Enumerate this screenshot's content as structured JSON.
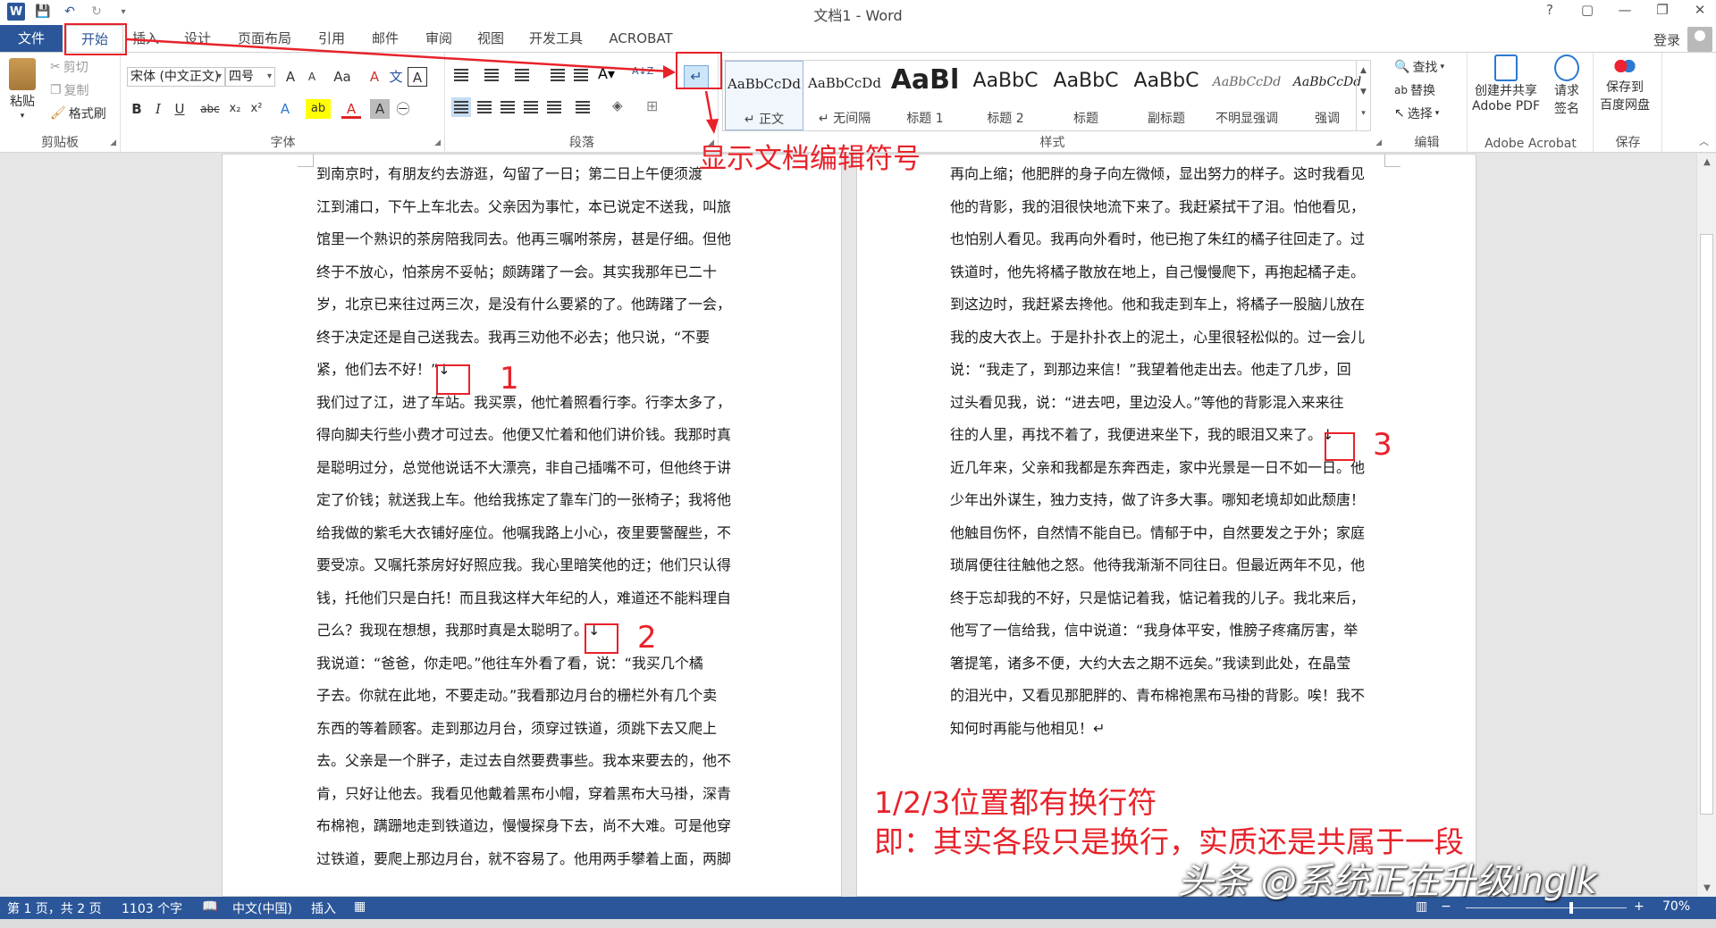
{
  "window": {
    "title": "文档1 - Word",
    "help": "?",
    "ribbon_display": "▢",
    "minimize": "—",
    "restore": "❐",
    "close": "✕"
  },
  "qat": {
    "word_logo": "W",
    "save": "💾",
    "undo": "↶",
    "redo": "↻",
    "more": "▾"
  },
  "tabs": [
    "文件",
    "开始",
    "插入",
    "设计",
    "页面布局",
    "引用",
    "邮件",
    "审阅",
    "视图",
    "开发工具",
    "ACROBAT"
  ],
  "active_tab": "开始",
  "account": {
    "login": "登录"
  },
  "clipboard": {
    "paste": "粘贴",
    "cut": "剪切",
    "copy": "复制",
    "format_painter": "格式刷",
    "label": "剪贴板"
  },
  "font": {
    "name": "宋体 (中文正文)",
    "size": "四号",
    "label": "字体",
    "grow": "A",
    "shrink": "A",
    "case": "Aa",
    "clear": "A",
    "phonetic": "文",
    "border": "A",
    "bold": "B",
    "italic": "I",
    "underline": "U",
    "strike": "abc",
    "sub": "x₂",
    "sup": "x²",
    "effect": "A",
    "highlight": "ab",
    "color": "A",
    "shade": "A",
    "enclose": "㊀"
  },
  "paragraph": {
    "label": "段落"
  },
  "styles": {
    "label": "样式",
    "items": [
      {
        "preview": "AaBbCcDd",
        "name": "↵ 正文"
      },
      {
        "preview": "AaBbCcDd",
        "name": "↵ 无间隔"
      },
      {
        "preview": "AaBl",
        "name": "标题 1"
      },
      {
        "preview": "AaBbC",
        "name": "标题 2"
      },
      {
        "preview": "AaBbC",
        "name": "标题"
      },
      {
        "preview": "AaBbC",
        "name": "副标题"
      },
      {
        "preview": "AaBbCcDd",
        "name": "不明显强调"
      },
      {
        "preview": "AaBbCcDd",
        "name": "强调"
      }
    ]
  },
  "editing": {
    "find": "查找",
    "replace": "替换",
    "select": "选择",
    "label": "编辑"
  },
  "acrobat": {
    "create_share": "创建并共享",
    "create_share2": "Adobe PDF",
    "request": "请求",
    "request2": "签名",
    "label": "Adobe Acrobat"
  },
  "save_cloud": {
    "line1": "保存到",
    "line2": "百度网盘",
    "label": "保存"
  },
  "document": {
    "left_lines": [
      "到南京时，有朋友约去游逛，勾留了一日；第二日上午便须渡",
      "江到浦口，下午上车北去。父亲因为事忙，本已说定不送我，叫旅",
      "馆里一个熟识的茶房陪我同去。他再三嘱咐茶房，甚是仔细。但他",
      "终于不放心，怕茶房不妥帖；颇踌躇了一会。其实我那年已二十",
      "岁，北京已来往过两三次，是没有什么要紧的了。他踌躇了一会，",
      "终于决定还是自己送我去。我再三劝他不必去；他只说，“不要",
      "紧，他们去不好！”↓",
      "我们过了江，进了车站。我买票，他忙着照看行李。行李太多了，",
      "得向脚夫行些小费才可过去。他便又忙着和他们讲价钱。我那时真",
      "是聪明过分，总觉他说话不大漂亮，非自己插嘴不可，但他终于讲",
      "定了价钱；就送我上车。他给我拣定了靠车门的一张椅子；我将他",
      "给我做的紫毛大衣铺好座位。他嘱我路上小心，夜里要警醒些，不",
      "要受凉。又嘱托茶房好好照应我。我心里暗笑他的迂；他们只认得",
      "钱，托他们只是白托！而且我这样大年纪的人，难道还不能料理自",
      "己么？我现在想想，我那时真是太聪明了。↓",
      "我说道：“爸爸，你走吧。”他往车外看了看，说：“我买几个橘",
      "子去。你就在此地，不要走动。”我看那边月台的栅栏外有几个卖",
      "东西的等着顾客。走到那边月台，须穿过铁道，须跳下去又爬上",
      "去。父亲是一个胖子，走过去自然要费事些。我本来要去的，他不",
      "肯，只好让他去。我看见他戴着黑布小帽，穿着黑布大马褂，深青",
      "布棉袍，蹒跚地走到铁道边，慢慢探身下去，尚不大难。可是他穿",
      "过铁道，要爬上那边月台，就不容易了。他用两手攀着上面，两脚"
    ],
    "right_lines": [
      "再向上缩；他肥胖的身子向左微倾，显出努力的样子。这时我看见",
      "他的背影，我的泪很快地流下来了。我赶紧拭干了泪。怕他看见，",
      "也怕别人看见。我再向外看时，他已抱了朱红的橘子往回走了。过",
      "铁道时，他先将橘子散放在地上，自己慢慢爬下，再抱起橘子走。",
      "到这边时，我赶紧去搀他。他和我走到车上，将橘子一股脑儿放在",
      "我的皮大衣上。于是扑扑衣上的泥土，心里很轻松似的。过一会儿",
      "说：“我走了，到那边来信！”我望着他走出去。他走了几步，回",
      "过头看见我，说：“进去吧，里边没人。”等他的背影混入来来往",
      "往的人里，再找不着了，我便进来坐下，我的眼泪又来了。↓",
      "近几年来，父亲和我都是东奔西走，家中光景是一日不如一日。他",
      "少年出外谋生，独力支持，做了许多大事。哪知老境却如此颓唐！",
      "他触目伤怀，自然情不能自已。情郁于中，自然要发之于外；家庭",
      "琐屑便往往触他之怒。他待我渐渐不同往日。但最近两年不见，他",
      "终于忘却我的不好，只是惦记着我，惦记着我的儿子。我北来后，",
      "他写了一信给我，信中说道：“我身体平安，惟膀子疼痛厉害，举",
      "箸提笔，诸多不便，大约大去之期不远矣。”我读到此处，在晶莹",
      "的泪光中，又看见那肥胖的、青布棉袍黑布马褂的背影。唉！我不",
      "知何时再能与他相见！↵"
    ]
  },
  "status": {
    "page": "第 1 页，共 2 页",
    "words": "1103 个字",
    "lang": "中文(中国)",
    "insert": "插入",
    "zoom": "70%",
    "zoom_minus": "−",
    "zoom_plus": "+"
  },
  "annotations": {
    "show_marks": "显示文档编辑符号",
    "n1": "1",
    "n2": "2",
    "n3": "3",
    "note1": "1/2/3位置都有换行符",
    "note2": "即：其实各段只是换行，实质还是共属于一段"
  },
  "watermark": "头条 @系统正在升级inglk",
  "colors": {
    "accent": "#2b579a",
    "annotation": "#e8222a"
  }
}
